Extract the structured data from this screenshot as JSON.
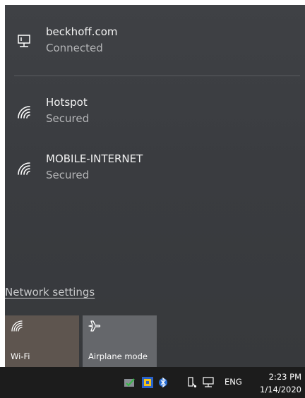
{
  "networks": [
    {
      "name": "beckhoff.com",
      "status": "Connected",
      "icon": "ethernet-icon"
    },
    {
      "name": "Hotspot",
      "status": "Secured",
      "icon": "wifi-icon"
    },
    {
      "name": "MOBILE-INTERNET",
      "status": "Secured",
      "icon": "wifi-icon"
    }
  ],
  "network_settings_label": "Network settings",
  "quick_actions": [
    {
      "label": "Wi-Fi",
      "icon": "wifi-icon",
      "state": "off"
    },
    {
      "label": "Airplane mode",
      "icon": "airplane-icon",
      "state": "off"
    }
  ],
  "taskbar": {
    "language": "ENG",
    "time": "2:23 PM",
    "date": "1/14/2020",
    "tray_icons": [
      "security-check-icon",
      "app-icon",
      "bluetooth-icon",
      "usb-drive-icon",
      "network-icon"
    ]
  },
  "colors": {
    "flyout_bg": "#3d3f43",
    "wifi_tile_bg": "#5e554f",
    "airplane_tile_bg": "#65676b",
    "taskbar_bg": "#1c1c1c"
  }
}
